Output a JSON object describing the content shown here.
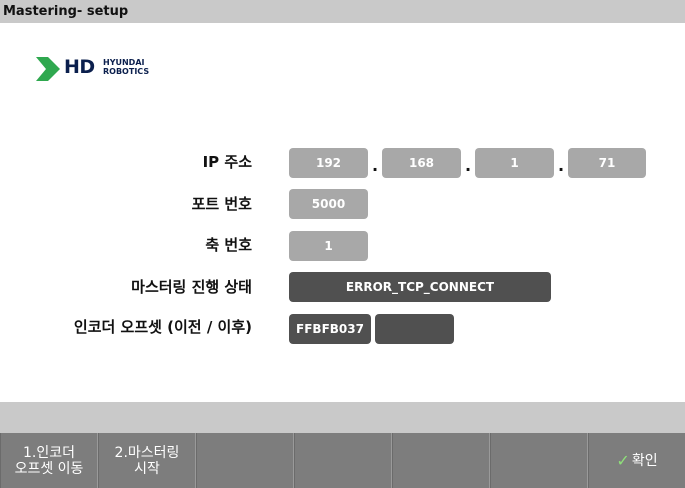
{
  "window": {
    "title": "Mastering- setup"
  },
  "logo": {
    "hd": "HD",
    "line1": "HYUNDAI",
    "line2": "ROBOTICS",
    "brand_color": "#0b1f4d",
    "mark_color": "#2fa84f"
  },
  "form": {
    "ip_label": "IP 주소",
    "ip": [
      "192",
      "168",
      "1",
      "71"
    ],
    "port_label": "포트 번호",
    "port": "5000",
    "axis_label": "축 번호",
    "axis": "1",
    "status_label": "마스터링 진행 상태",
    "status": "ERROR_TCP_CONNECT",
    "offset_label": "인코더 오프셋 (이전 / 이후)",
    "offset_before": "FFBFB037",
    "offset_after": ""
  },
  "fkeys": [
    {
      "label": "1.인코더\n오프셋 이동"
    },
    {
      "label": "2.마스터링\n시작"
    },
    {
      "label": ""
    },
    {
      "label": ""
    },
    {
      "label": ""
    },
    {
      "label": ""
    },
    {
      "label": "확인",
      "icon": "check-icon"
    }
  ]
}
